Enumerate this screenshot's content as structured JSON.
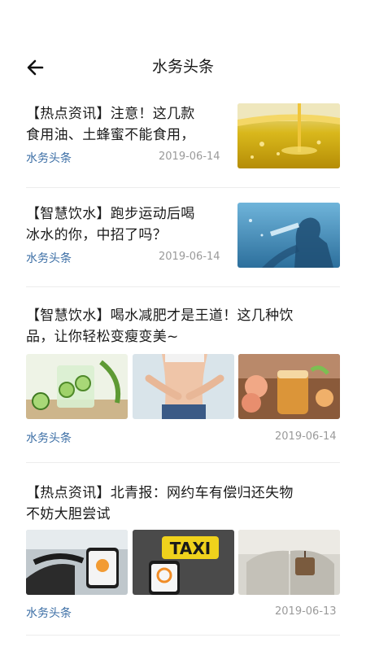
{
  "header": {
    "title": "水务头条",
    "back_icon": "arrow-left-icon"
  },
  "articles": [
    {
      "title_line1": "【热点资讯】注意！这几款",
      "title_line2": "食用油、土蜂蜜不能食用，",
      "source": "水务头条",
      "date": "2019-06-14",
      "images": [
        "cooking-oil-pour"
      ]
    },
    {
      "title_line1": "【智慧饮水】跑步运动后喝",
      "title_line2": "冰水的你，中招了吗？",
      "source": "水务头条",
      "date": "2019-06-14",
      "images": [
        "man-drinking-water-silhouette"
      ]
    },
    {
      "title_line1": "【智慧饮水】喝水减肥才是王道！这几种饮",
      "title_line2": "品，让你轻松变瘦变美~",
      "source": "水务头条",
      "date": "2019-06-14",
      "images": [
        "cucumber-drink",
        "slim-waist",
        "peach-iced-tea"
      ]
    },
    {
      "title_line1": "【热点资讯】北青报：网约车有偿归还失物",
      "title_line2": "不妨大胆尝试",
      "source": "水务头条",
      "date": "2019-06-13",
      "images": [
        "phone-in-car",
        "taxi-sign-didi",
        "car-back-seat"
      ],
      "taxi_sign_text": "TAXI"
    }
  ],
  "colors": {
    "source_link": "#3b6ea5",
    "date_text": "#9a9a9a",
    "divider": "#ececec"
  }
}
